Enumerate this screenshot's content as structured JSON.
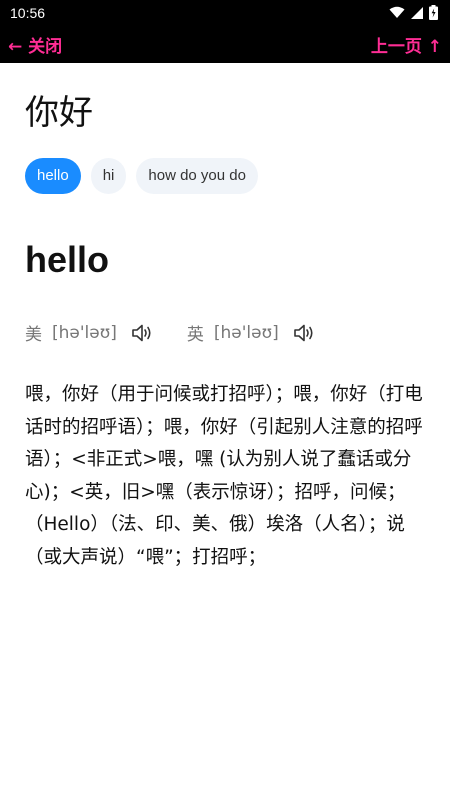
{
  "status": {
    "time": "10:56"
  },
  "topbar": {
    "close_label": "← 关闭",
    "prev_label": "上一页 ↑"
  },
  "query": "你好",
  "chips": [
    "hello",
    "hi",
    "how do you do"
  ],
  "active_chip_index": 0,
  "entry": {
    "word": "hello",
    "us_label": "美",
    "us_ipa": "[hə'ləʊ]",
    "uk_label": "英",
    "uk_ipa": "[hə'ləʊ]",
    "definition": " 喂，你好（用于问候或打招呼）；喂，你好（打电话时的招呼语）；喂，你好（引起别人注意的招呼语）；<非正式>喂，嘿 (认为别人说了蠢话或分心)；<英，旧>嘿（表示惊讶）；招呼，问候；（Hello）（法、印、美、俄）埃洛（人名）；说（或大声说）“喂”；打招呼；"
  },
  "colors": {
    "accent": "#ff2d95",
    "chip_active": "#1a8cff",
    "chip_bg": "#f0f4f9"
  }
}
